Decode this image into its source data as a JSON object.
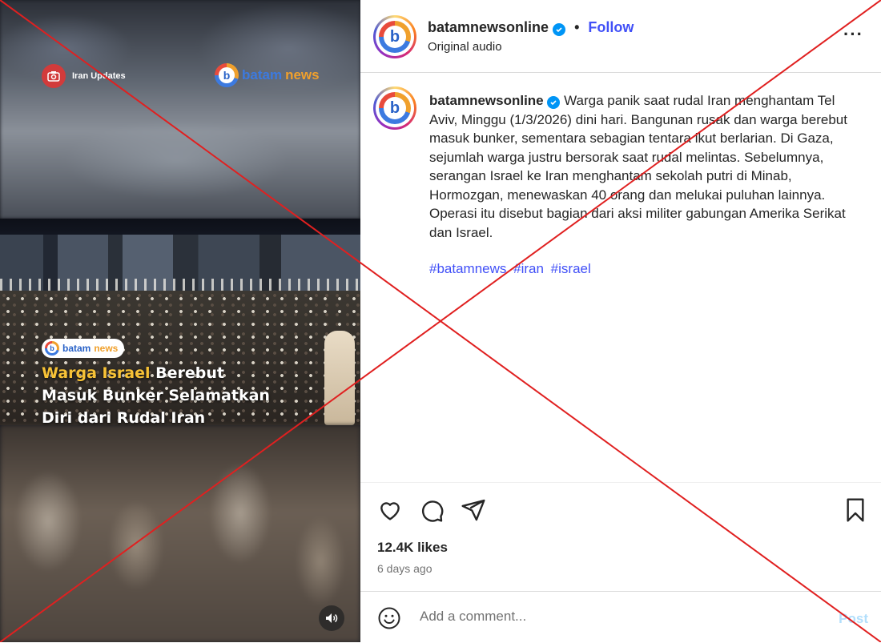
{
  "media": {
    "badge_left": "Iran Updates",
    "brand_top_a": "batam",
    "brand_top_b": "news",
    "pill_a": "batam",
    "pill_b": "news",
    "headline_highlight": "Warga Israel",
    "headline_rest_1": " Berebut",
    "headline_line_2": "Masuk Bunker Selamatkan",
    "headline_line_3": "Diri dari Rudal Iran",
    "sound_icon": "speaker-icon"
  },
  "header": {
    "username": "batamnewsonline",
    "separator": "•",
    "follow_label": "Follow",
    "subtitle": "Original audio",
    "more_label": "···"
  },
  "caption": {
    "username": "batamnewsonline",
    "text": "Warga panik saat rudal Iran menghantam Tel Aviv, Minggu (1/3/2026) dini hari. Bangunan rusak dan warga berebut masuk bunker, sementara sebagian tentara ikut berlarian. Di Gaza, sejumlah warga justru bersorak saat rudal melintas. Sebelumnya, serangan Israel ke Iran menghantam sekolah putri di Minab, Hormozgan, menewaskan 40 orang dan melukai puluhan lainnya. Operasi itu disebut bagian dari aksi militer gabungan Amerika Serikat dan Israel.",
    "hashtags": [
      "#batamnews",
      "#iran",
      "#israel"
    ]
  },
  "actions": {
    "likes": "12.4K likes",
    "time_ago": "6 days ago"
  },
  "comment": {
    "placeholder": "Add a comment...",
    "post_label": "Post"
  },
  "colors": {
    "link": "#4150f7",
    "verified": "#0095f6",
    "cross": "#e02020",
    "highlight": "#f7c236"
  }
}
